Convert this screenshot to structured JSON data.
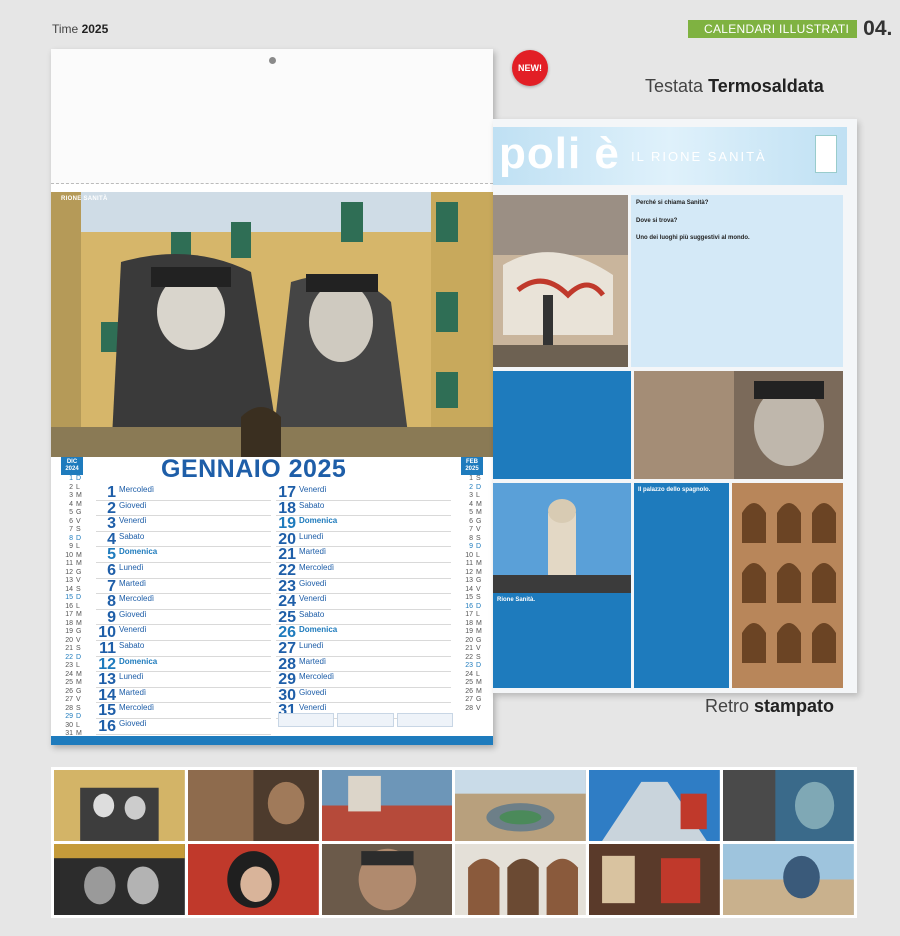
{
  "header": {
    "brand_prefix": "Time",
    "brand_year": "2025",
    "section_label": "CALENDARI ILLUSTRATI",
    "page_number": "04."
  },
  "badge": "NEW!",
  "captions": {
    "top_plain": "Testata",
    "top_bold": "Termosaldata",
    "bottom_plain": "Retro",
    "bottom_bold": "stampato"
  },
  "calendar": {
    "photo_label": "RIONE SANITÀ",
    "month": "GENNAIO",
    "year": "2025",
    "prev_month": {
      "label": "DIC",
      "year": "2024"
    },
    "next_month": {
      "label": "FEB",
      "year": "2025"
    },
    "prev_days": [
      "1 D",
      "2 L",
      "3 M",
      "4 M",
      "5 G",
      "6 V",
      "7 S",
      "8 D",
      "9 L",
      "10 M",
      "11 M",
      "12 G",
      "13 V",
      "14 S",
      "15 D",
      "16 L",
      "17 M",
      "18 M",
      "19 G",
      "20 V",
      "21 S",
      "22 D",
      "23 L",
      "24 M",
      "25 M",
      "26 G",
      "27 V",
      "28 S",
      "29 D",
      "30 L",
      "31 M"
    ],
    "next_days": [
      "1 S",
      "2 D",
      "3 L",
      "4 M",
      "5 M",
      "6 G",
      "7 V",
      "8 S",
      "9 D",
      "10 L",
      "11 M",
      "12 M",
      "13 G",
      "14 V",
      "15 S",
      "16 D",
      "17 L",
      "18 M",
      "19 M",
      "20 G",
      "21 V",
      "22 S",
      "23 D",
      "24 L",
      "25 M",
      "26 M",
      "27 G",
      "28 V"
    ],
    "days": [
      {
        "n": "1",
        "name": "Mercoledì"
      },
      {
        "n": "2",
        "name": "Giovedì"
      },
      {
        "n": "3",
        "name": "Venerdì"
      },
      {
        "n": "4",
        "name": "Sabato"
      },
      {
        "n": "5",
        "name": "Domenica"
      },
      {
        "n": "6",
        "name": "Lunedì"
      },
      {
        "n": "7",
        "name": "Martedì"
      },
      {
        "n": "8",
        "name": "Mercoledì"
      },
      {
        "n": "9",
        "name": "Giovedì"
      },
      {
        "n": "10",
        "name": "Venerdì"
      },
      {
        "n": "11",
        "name": "Sabato"
      },
      {
        "n": "12",
        "name": "Domenica"
      },
      {
        "n": "13",
        "name": "Lunedì"
      },
      {
        "n": "14",
        "name": "Martedì"
      },
      {
        "n": "15",
        "name": "Mercoledì"
      },
      {
        "n": "16",
        "name": "Giovedì"
      },
      {
        "n": "17",
        "name": "Venerdì"
      },
      {
        "n": "18",
        "name": "Sabato"
      },
      {
        "n": "19",
        "name": "Domenica"
      },
      {
        "n": "20",
        "name": "Lunedì"
      },
      {
        "n": "21",
        "name": "Martedì"
      },
      {
        "n": "22",
        "name": "Mercoledì"
      },
      {
        "n": "23",
        "name": "Giovedì"
      },
      {
        "n": "24",
        "name": "Venerdì"
      },
      {
        "n": "25",
        "name": "Sabato"
      },
      {
        "n": "26",
        "name": "Domenica"
      },
      {
        "n": "27",
        "name": "Lunedì"
      },
      {
        "n": "28",
        "name": "Martedì"
      },
      {
        "n": "29",
        "name": "Mercoledì"
      },
      {
        "n": "30",
        "name": "Giovedì"
      },
      {
        "n": "31",
        "name": "Venerdì"
      }
    ]
  },
  "spread": {
    "head_big": "poli è",
    "head_sub": "IL RIONE SANITÀ",
    "q1": "Perché si chiama Sanità?",
    "q2": "Dove si trova?",
    "q3": "Uno dei luoghi più suggestivi al mondo.",
    "q4": "Il palazzo dello spagnolo.",
    "q5": "Rione Sanità."
  },
  "colors": {
    "accent_blue": "#1e5ea8",
    "green": "#7fb241",
    "badge_red": "#e21f26"
  }
}
